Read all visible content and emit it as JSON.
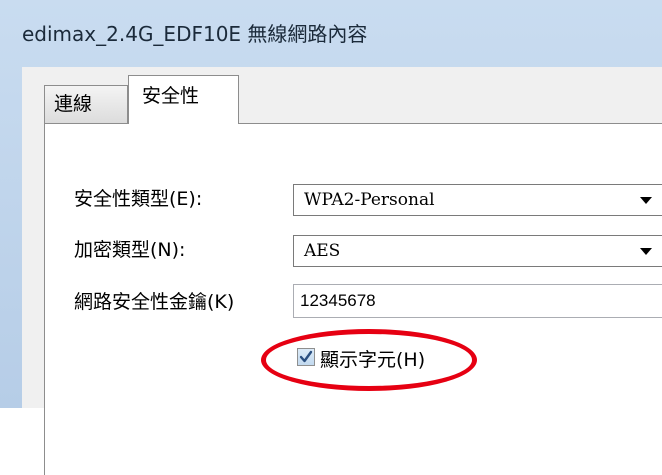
{
  "window": {
    "title": "edimax_2.4G_EDF10E 無線網路內容"
  },
  "tabs": [
    {
      "label": "連線",
      "active": false
    },
    {
      "label": "安全性",
      "active": true
    }
  ],
  "security": {
    "type_label": "安全性類型(E):",
    "type_value": "WPA2-Personal",
    "encryption_label": "加密類型(N):",
    "encryption_value": "AES",
    "key_label": "網路安全性金鑰(K)",
    "key_value": "12345678",
    "show_chars_label": "顯示字元(H)",
    "show_chars_checked": true
  },
  "annotation": {
    "highlight_color": "#e60012"
  }
}
